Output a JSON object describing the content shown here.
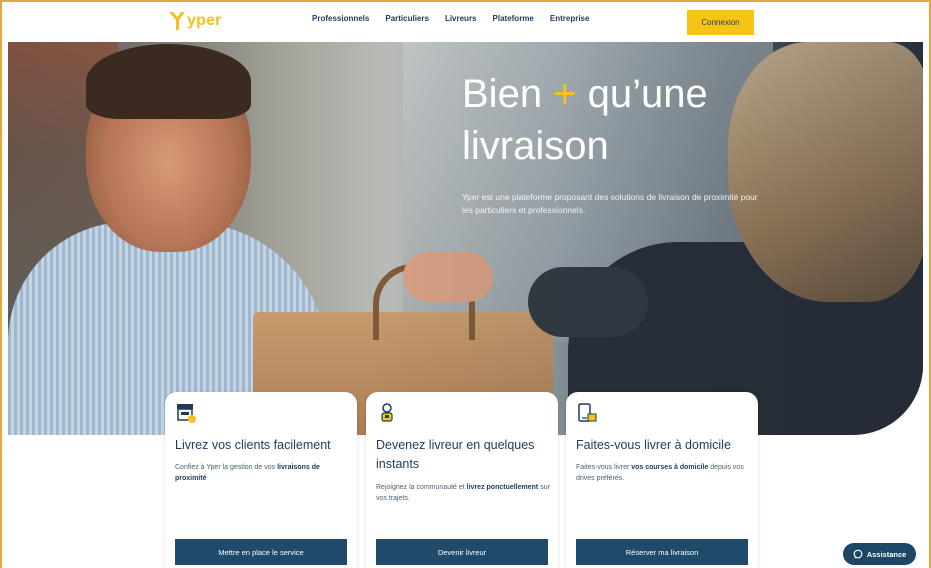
{
  "header": {
    "logo_text": "yper",
    "nav": [
      "Professionnels",
      "Particuliers",
      "Livreurs",
      "Plateforme",
      "Entreprise"
    ],
    "login_label": "Connexion"
  },
  "hero": {
    "title_part1": "Bien ",
    "title_plus": "+",
    "title_part2": " qu’une livraison",
    "subtitle": "Yper est une plateforme proposant des solutions de livraison de proximité pour les particuliers et professionnels."
  },
  "cards": [
    {
      "icon": "storefront-icon",
      "title": "Livrez vos clients facilement",
      "desc_pre": "Confiez à Yper la gestion de vos ",
      "desc_bold": "livraisons de proximité",
      "desc_post": "",
      "button": "Mettre en place le service"
    },
    {
      "icon": "courier-icon",
      "title": "Devenez livreur en quelques instants",
      "desc_pre": "Rejoignez la communauté et ",
      "desc_bold": "livrez ponctuellement",
      "desc_post": " sur vos trajets.",
      "button": "Devenir livreur"
    },
    {
      "icon": "phone-parcel-icon",
      "title": "Faites-vous livrer à domicile",
      "desc_pre": "Faites-vous livrer ",
      "desc_bold": "vos courses à domicile",
      "desc_post": " depuis vos drives préférés.",
      "button": "Réserver ma livraison"
    }
  ],
  "assistance": {
    "label": "Assistance",
    "icon": "chat-bubble-icon"
  },
  "colors": {
    "brand_yellow": "#f7c416",
    "navy": "#1f4a6b",
    "text": "#1f3b57"
  }
}
